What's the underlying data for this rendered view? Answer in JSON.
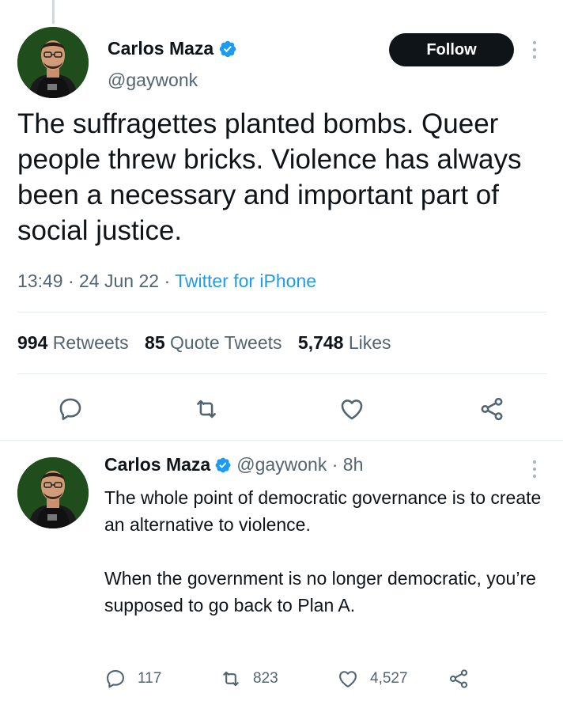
{
  "main_tweet": {
    "author": {
      "name": "Carlos Maza",
      "handle": "@gaywonk"
    },
    "follow_label": "Follow",
    "text": "The suffragettes planted bombs. Queer people threw bricks. Violence has always been a necessary and important part of social justice.",
    "time": "13:49",
    "date": "24 Jun 22",
    "source": "Twitter for iPhone",
    "stats": {
      "retweets_count": "994",
      "retweets_label": "Retweets",
      "quotes_count": "85",
      "quotes_label": "Quote Tweets",
      "likes_count": "5,748",
      "likes_label": "Likes"
    }
  },
  "reply_tweet": {
    "author": {
      "name": "Carlos Maza",
      "handle": "@gaywonk"
    },
    "age": "8h",
    "text": "The whole point of democratic governance is to create an alternative to violence.\n\nWhen the government is no longer democratic, you’re supposed to go back to Plan A.",
    "replies": "117",
    "retweets": "823",
    "likes": "4,527"
  },
  "colors": {
    "accent": "#1d9bf0",
    "text": "#0f1419",
    "muted": "#536471",
    "divider": "#e6ecf0"
  },
  "icons": [
    "verified-badge-icon",
    "more-icon",
    "reply-icon",
    "retweet-icon",
    "like-icon",
    "share-icon"
  ]
}
